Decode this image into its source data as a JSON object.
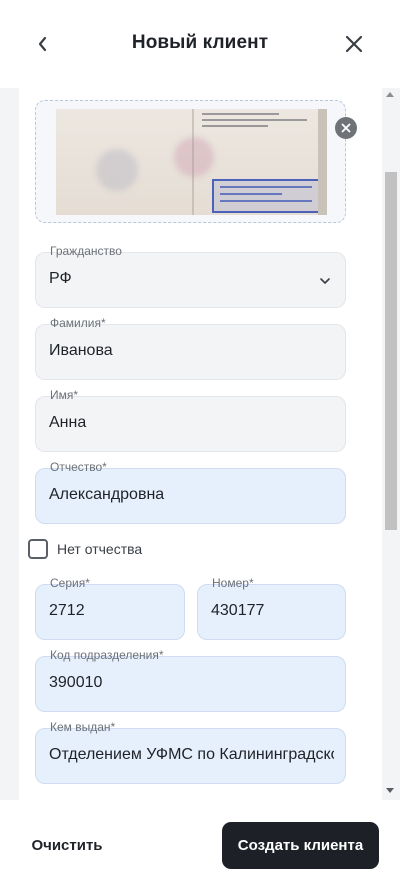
{
  "header": {
    "title": "Новый клиент",
    "back_icon": "chevron-left-icon",
    "close_icon": "close-icon"
  },
  "document_photo": {
    "remove_icon": "close-icon"
  },
  "form": {
    "citizenship": {
      "label": "Гражданство",
      "value": "РФ"
    },
    "last_name": {
      "label": "Фамилия*",
      "value": "Иванова"
    },
    "first_name": {
      "label": "Имя*",
      "value": "Анна"
    },
    "patronymic": {
      "label": "Отчество*",
      "value": "Александровна"
    },
    "no_patronymic": {
      "label": "Нет отчества",
      "checked": false
    },
    "series": {
      "label": "Серия*",
      "value": "2712"
    },
    "number": {
      "label": "Номер*",
      "value": "430177"
    },
    "division_code": {
      "label": "Код подразделения*",
      "value": "390010"
    },
    "issued_by": {
      "label": "Кем выдан*",
      "value": "Отделением УФМС по Калининградской"
    }
  },
  "footer": {
    "clear_label": "Очистить",
    "create_label": "Создать клиента"
  },
  "colors": {
    "accent_dark": "#1d2127",
    "filled_field_bg": "#e6effc",
    "empty_field_bg": "#f3f4f6"
  }
}
